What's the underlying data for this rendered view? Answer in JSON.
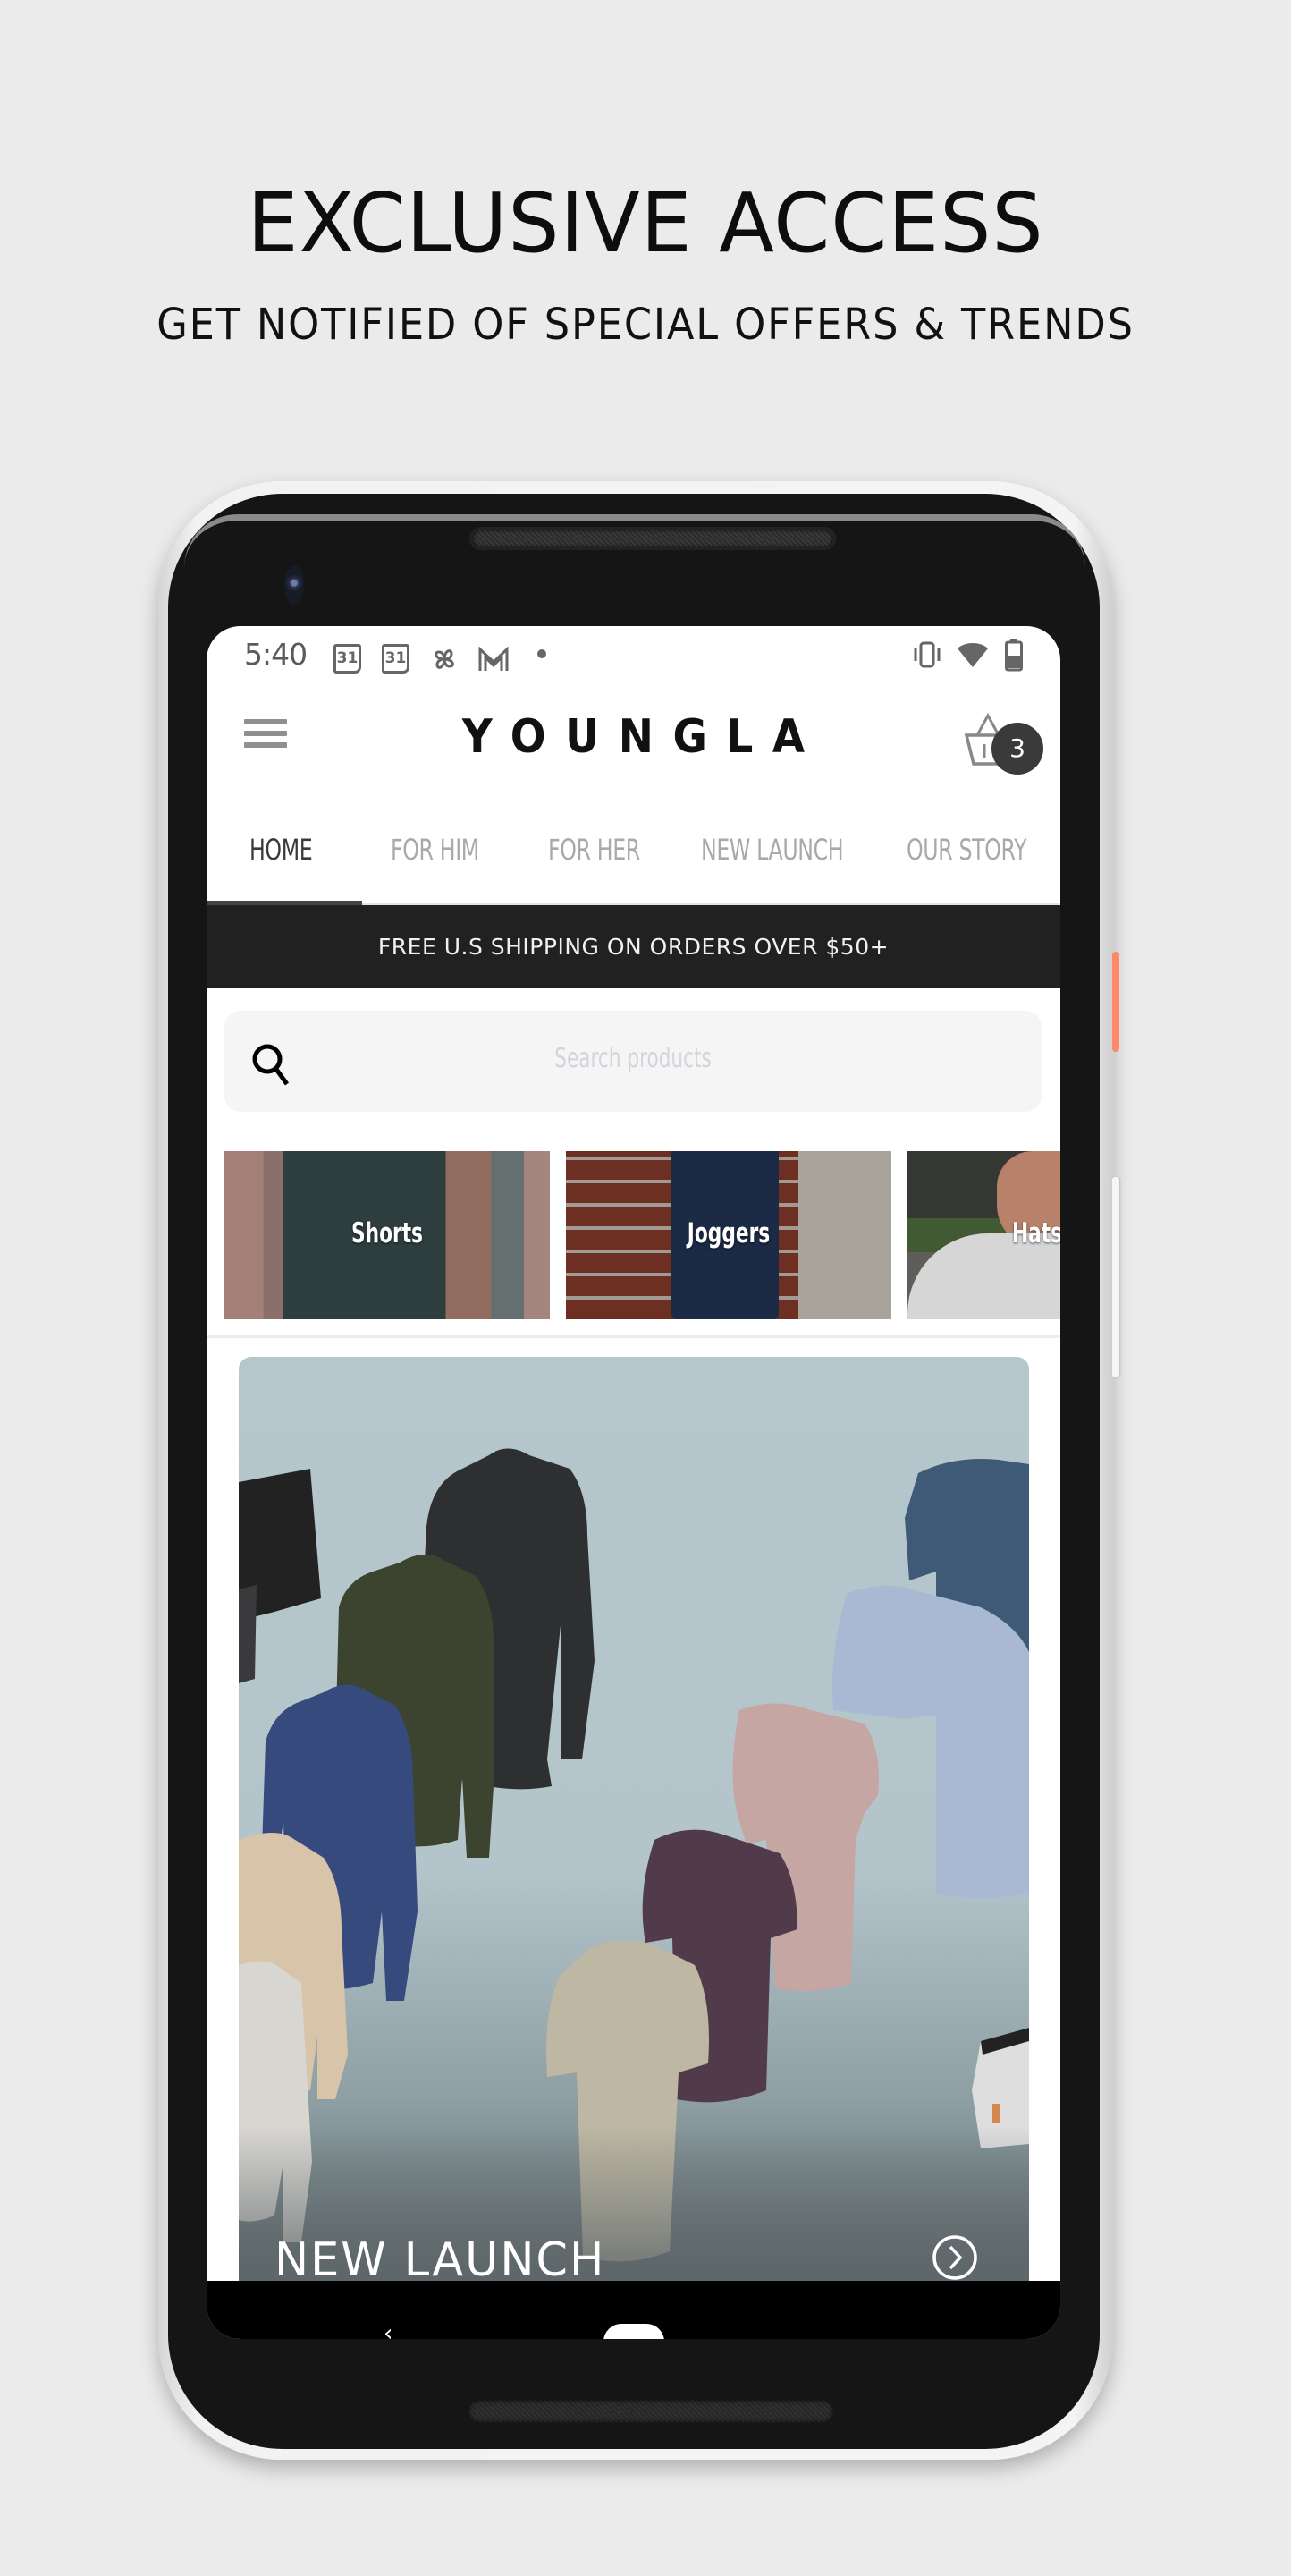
{
  "promo": {
    "headline": "EXCLUSIVE ACCESS",
    "subheadline": "GET NOTIFIED OF SPECIAL OFFERS & TRENDS"
  },
  "status_bar": {
    "time": "5:40",
    "left_icons": [
      "calendar-icon",
      "calendar-icon",
      "pinwheel-icon",
      "gmail-icon",
      "dot-icon"
    ],
    "calendar_day": "31",
    "right_icons": [
      "vibrate-icon",
      "wifi-icon",
      "battery-icon"
    ]
  },
  "header": {
    "logo": "YOUNGLA",
    "cart_count": "3"
  },
  "tabs": [
    {
      "label": "HOME",
      "active": true
    },
    {
      "label": "FOR HIM",
      "active": false
    },
    {
      "label": "FOR HER",
      "active": false
    },
    {
      "label": "NEW LAUNCH",
      "active": false
    },
    {
      "label": "OUR STORY",
      "active": false
    }
  ],
  "announcement": "FREE U.S SHIPPING ON ORDERS OVER $50+",
  "search": {
    "placeholder": "Search products",
    "value": ""
  },
  "categories": [
    {
      "label": "Shorts"
    },
    {
      "label": "Joggers"
    },
    {
      "label": "Hats/"
    }
  ],
  "banner": {
    "title": "NEW LAUNCH"
  },
  "colors": {
    "background": "#ebebeb",
    "promo_bar": "#212121",
    "active_tab": "#3a3a3a",
    "inactive_tab": "#a9a9a9",
    "cart_badge": "#3a3a3a",
    "power_button": "#ff8866"
  }
}
